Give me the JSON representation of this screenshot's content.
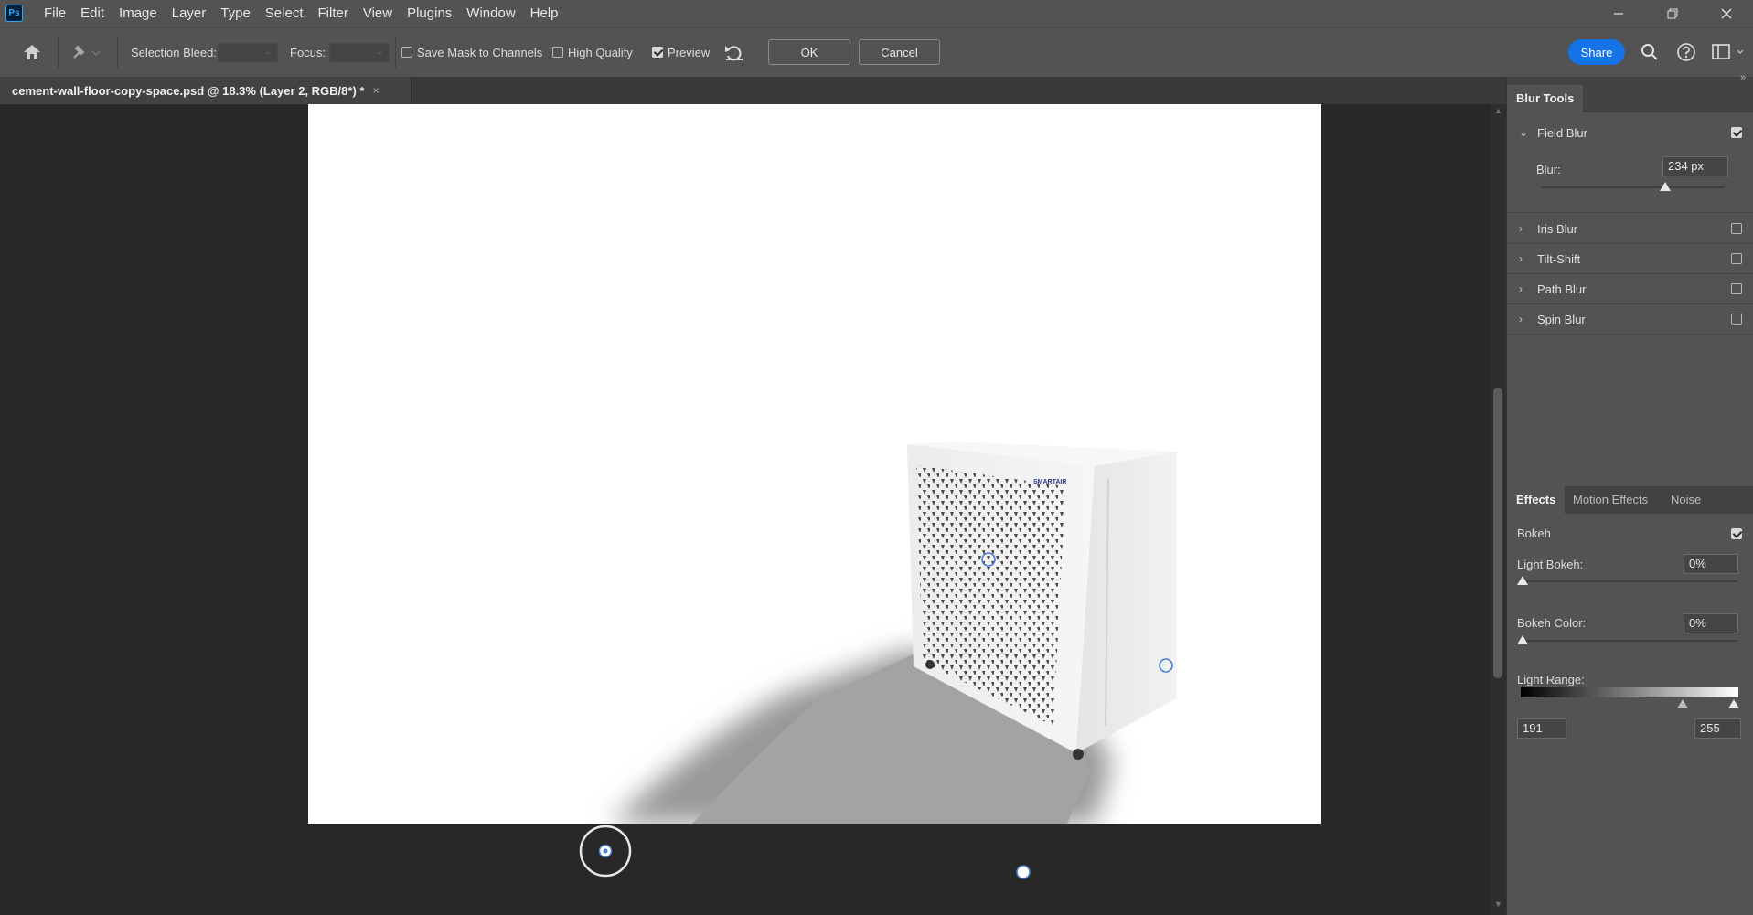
{
  "menubar": {
    "app_icon": "ps-logo",
    "app_icon_text": "Ps",
    "items": [
      "File",
      "Edit",
      "Image",
      "Layer",
      "Type",
      "Select",
      "Filter",
      "View",
      "Plugins",
      "Window",
      "Help"
    ],
    "window_controls": {
      "minimize": "—",
      "restore": "❐",
      "close": "✕"
    }
  },
  "options_bar": {
    "selection_bleed_label": "Selection Bleed:",
    "focus_label": "Focus:",
    "save_mask_label": "Save Mask to Channels",
    "save_mask_checked": false,
    "high_quality_label": "High Quality",
    "high_quality_checked": false,
    "preview_label": "Preview",
    "preview_checked": true,
    "ok_label": "OK",
    "cancel_label": "Cancel",
    "share_label": "Share"
  },
  "document": {
    "tab_title": "cement-wall-floor-copy-space.psd @ 18.3% (Layer 2, RGB/8*) *",
    "tab_close": "×",
    "product_logo": "SMARTAIR"
  },
  "blur_tools": {
    "tab_label": "Blur Tools",
    "field_blur": {
      "label": "Field Blur",
      "checked": true,
      "blur_label": "Blur:",
      "blur_value": "234 px"
    },
    "others": [
      {
        "label": "Iris Blur",
        "checked": false
      },
      {
        "label": "Tilt-Shift",
        "checked": false
      },
      {
        "label": "Path Blur",
        "checked": false
      },
      {
        "label": "Spin Blur",
        "checked": false
      }
    ]
  },
  "effects": {
    "tabs": [
      "Effects",
      "Motion Effects",
      "Noise"
    ],
    "active_tab": "Effects",
    "bokeh_label": "Bokeh",
    "bokeh_checked": true,
    "light_bokeh_label": "Light Bokeh:",
    "light_bokeh_value": "0%",
    "bokeh_color_label": "Bokeh Color:",
    "bokeh_color_value": "0%",
    "light_range_label": "Light Range:",
    "light_range_min": "191",
    "light_range_max": "255"
  },
  "colors": {
    "ui_bg": "#535353",
    "pasteboard": "#282828",
    "accent_blue": "#1473e6",
    "pin_blue": "#4a7fd4"
  }
}
